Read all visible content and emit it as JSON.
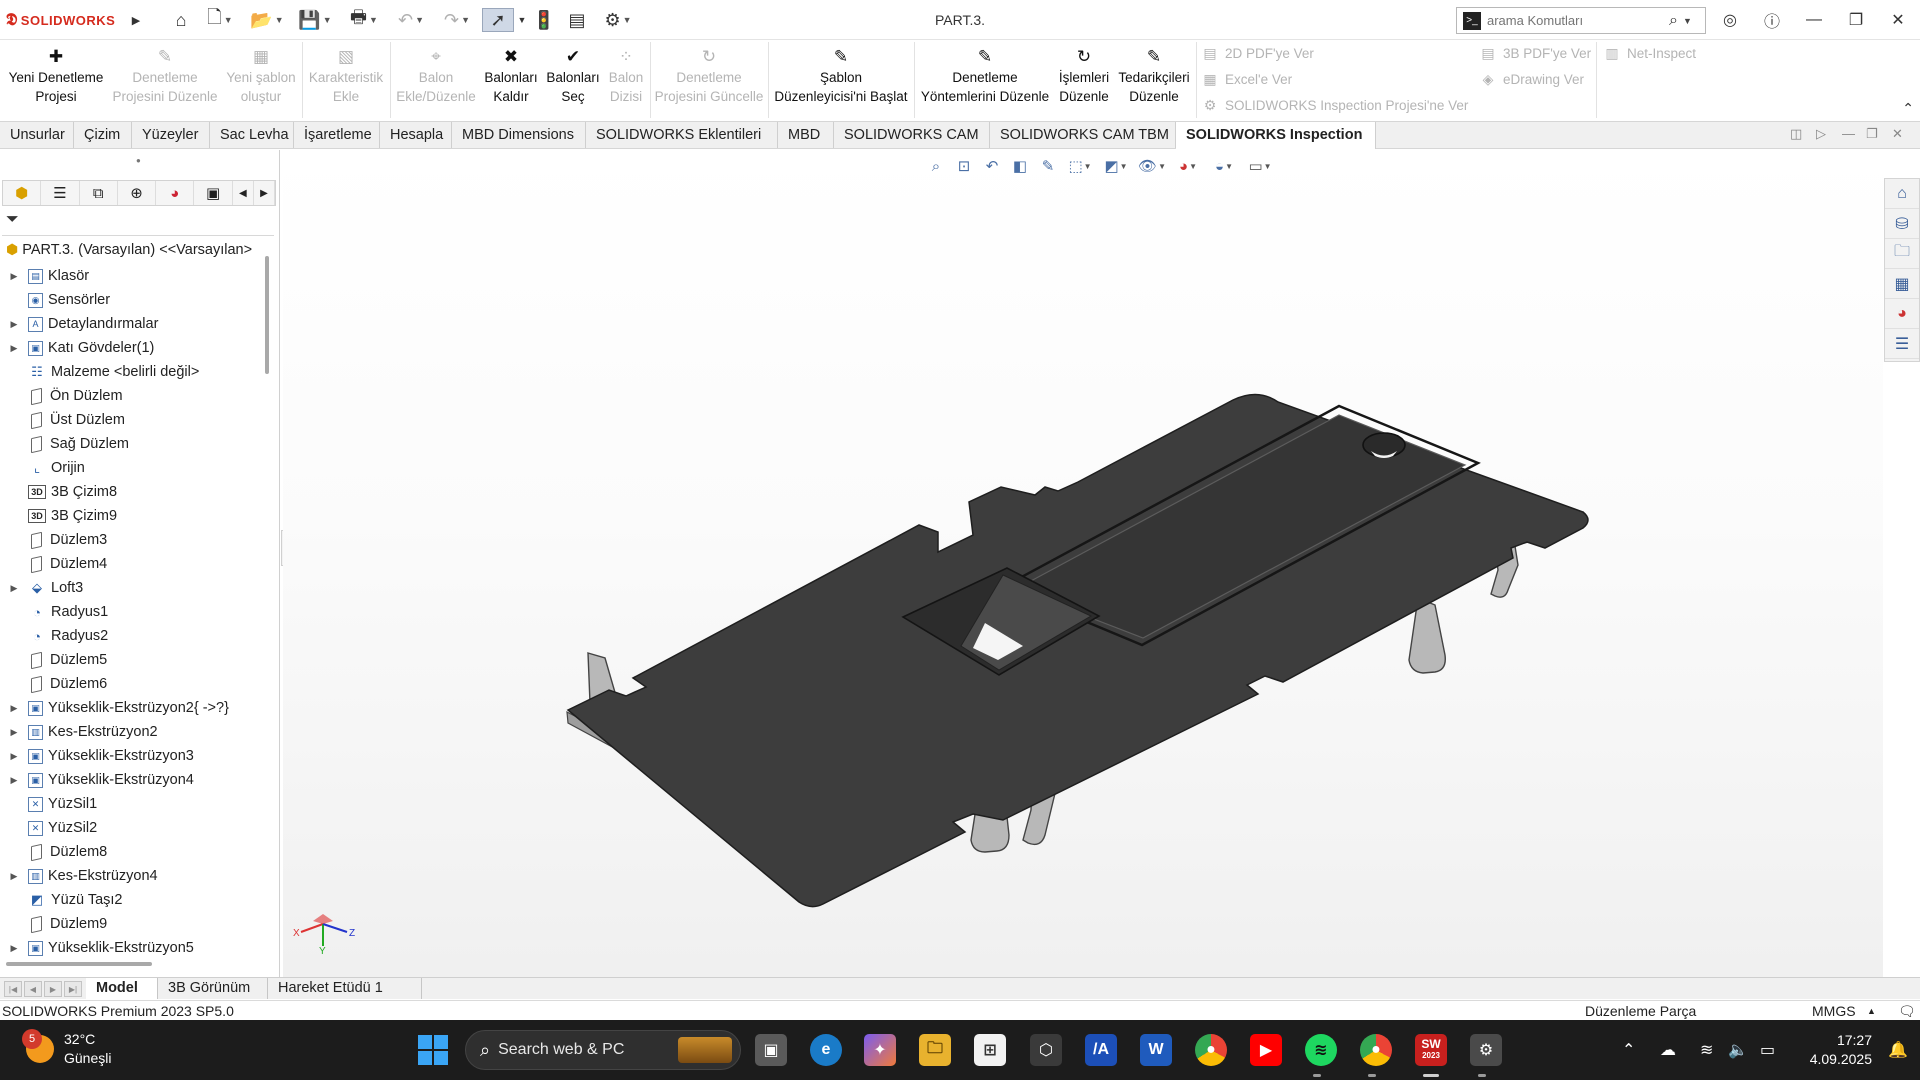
{
  "app": {
    "brand": "SOLIDWORKS",
    "document_title": "PART.3.",
    "search_placeholder": "arama Komutları"
  },
  "command_manager": {
    "left": [
      {
        "line1": "Yeni Denetleme",
        "line2": "Projesi",
        "enabled": true,
        "icon": "new-inspection-icon"
      },
      {
        "line1": "Denetleme",
        "line2": "Projesini Düzenle",
        "enabled": false,
        "icon": "edit-inspection-icon"
      },
      {
        "line1": "Yeni şablon",
        "line2": "oluştur",
        "enabled": false,
        "icon": "new-template-icon"
      },
      {
        "line1": "Karakteristik",
        "line2": "Ekle",
        "enabled": false,
        "icon": "add-characteristic-icon"
      },
      {
        "line1": "Balon",
        "line2": "Ekle/Düzenle",
        "enabled": false,
        "icon": "balloon-icon"
      },
      {
        "line1": "Balonları",
        "line2": "Kaldır",
        "enabled": true,
        "icon": "remove-balloons-icon"
      },
      {
        "line1": "Balonları",
        "line2": "Seç",
        "enabled": true,
        "icon": "select-balloons-icon"
      },
      {
        "line1": "Balon",
        "line2": "Dizisi",
        "enabled": false,
        "icon": "balloon-pattern-icon"
      },
      {
        "line1": "Denetleme",
        "line2": "Projesini Güncelle",
        "enabled": false,
        "icon": "update-inspection-icon"
      },
      {
        "line1": "Şablon",
        "line2": "Düzenleyicisi'ni Başlat",
        "enabled": true,
        "icon": "template-editor-icon"
      },
      {
        "line1": "Denetleme",
        "line2": "Yöntemlerini Düzenle",
        "enabled": true,
        "icon": "edit-methods-icon"
      },
      {
        "line1": "İşlemleri",
        "line2": "Düzenle",
        "enabled": true,
        "icon": "edit-operations-icon"
      },
      {
        "line1": "Tedarikçileri",
        "line2": "Düzenle",
        "enabled": true,
        "icon": "edit-vendors-icon"
      }
    ],
    "export_2d_pdf": "2D PDF'ye Ver",
    "export_excel": "Excel'e Ver",
    "export_inspection_project": "SOLIDWORKS Inspection Projesi'ne Ver",
    "export_3d_pdf": "3B PDF'ye Ver",
    "export_edrawing": "eDrawing Ver",
    "net_inspect": "Net-Inspect"
  },
  "tabs": [
    {
      "label": "Unsurlar",
      "active": false
    },
    {
      "label": "Çizim",
      "active": false
    },
    {
      "label": "Yüzeyler",
      "active": false
    },
    {
      "label": "Sac Levha",
      "active": false
    },
    {
      "label": "İşaretleme",
      "active": false
    },
    {
      "label": "Hesapla",
      "active": false
    },
    {
      "label": "MBD Dimensions",
      "active": false
    },
    {
      "label": "SOLIDWORKS Eklentileri",
      "active": false
    },
    {
      "label": "MBD",
      "active": false
    },
    {
      "label": "SOLIDWORKS CAM",
      "active": false
    },
    {
      "label": "SOLIDWORKS CAM TBM",
      "active": false
    },
    {
      "label": "SOLIDWORKS Inspection",
      "active": true
    }
  ],
  "feature_tree": {
    "root": "PART.3. (Varsayılan) <<Varsayılan>",
    "items": [
      {
        "label": "Klasör",
        "expandable": true,
        "icon": "folder-icon"
      },
      {
        "label": "Sensörler",
        "expandable": false,
        "icon": "sensor-icon"
      },
      {
        "label": "Detaylandırmalar",
        "expandable": true,
        "icon": "annotation-icon"
      },
      {
        "label": "Katı Gövdeler(1)",
        "expandable": true,
        "icon": "solid-bodies-icon"
      },
      {
        "label": "Malzeme <belirli değil>",
        "expandable": false,
        "icon": "material-icon"
      },
      {
        "label": "Ön Düzlem",
        "expandable": false,
        "icon": "plane-icon"
      },
      {
        "label": "Üst Düzlem",
        "expandable": false,
        "icon": "plane-icon"
      },
      {
        "label": "Sağ Düzlem",
        "expandable": false,
        "icon": "plane-icon"
      },
      {
        "label": "Orijin",
        "expandable": false,
        "icon": "origin-icon"
      },
      {
        "label": "3B Çizim8",
        "expandable": false,
        "icon": "sketch-3d-icon"
      },
      {
        "label": "3B Çizim9",
        "expandable": false,
        "icon": "sketch-3d-icon"
      },
      {
        "label": "Düzlem3",
        "expandable": false,
        "icon": "plane-icon"
      },
      {
        "label": "Düzlem4",
        "expandable": false,
        "icon": "plane-icon"
      },
      {
        "label": "Loft3",
        "expandable": true,
        "icon": "loft-icon"
      },
      {
        "label": "Radyus1",
        "expandable": false,
        "icon": "fillet-icon"
      },
      {
        "label": "Radyus2",
        "expandable": false,
        "icon": "fillet-icon"
      },
      {
        "label": "Düzlem5",
        "expandable": false,
        "icon": "plane-icon"
      },
      {
        "label": "Düzlem6",
        "expandable": false,
        "icon": "plane-icon"
      },
      {
        "label": "Yükseklik-Ekstrüzyon2{ ->?}",
        "expandable": true,
        "icon": "boss-extrude-icon"
      },
      {
        "label": "Kes-Ekstrüzyon2",
        "expandable": true,
        "icon": "cut-extrude-icon"
      },
      {
        "label": "Yükseklik-Ekstrüzyon3",
        "expandable": true,
        "icon": "boss-extrude-icon"
      },
      {
        "label": "Yükseklik-Ekstrüzyon4",
        "expandable": true,
        "icon": "boss-extrude-icon"
      },
      {
        "label": "YüzSil1",
        "expandable": false,
        "icon": "delete-face-icon"
      },
      {
        "label": "YüzSil2",
        "expandable": false,
        "icon": "delete-face-icon"
      },
      {
        "label": "Düzlem8",
        "expandable": false,
        "icon": "plane-icon"
      },
      {
        "label": "Kes-Ekstrüzyon4",
        "expandable": true,
        "icon": "cut-extrude-icon"
      },
      {
        "label": "Yüzü Taşı2",
        "expandable": false,
        "icon": "move-face-icon"
      },
      {
        "label": "Düzlem9",
        "expandable": false,
        "icon": "plane-icon"
      },
      {
        "label": "Yükseklik-Ekstrüzyon5",
        "expandable": true,
        "icon": "boss-extrude-icon"
      }
    ]
  },
  "triad": {
    "x": "X",
    "y": "Y",
    "z": "Z"
  },
  "bottom_tabs": [
    {
      "label": "Model",
      "active": true
    },
    {
      "label": "3B Görünüm",
      "active": false
    },
    {
      "label": "Hareket Etüdü 1",
      "active": false
    }
  ],
  "status_bar": {
    "version": "SOLIDWORKS Premium 2023 SP5.0",
    "mode": "Düzenleme Parça",
    "units": "MMGS"
  },
  "taskbar": {
    "weather_badge": "5",
    "temperature": "32°C",
    "condition": "Güneşli",
    "search_text": "Search web & PC",
    "time": "17:27",
    "date": "4.09.2025",
    "sw_badge": "SW",
    "sw_year": "2023"
  },
  "colors": {
    "model_top": "#3d3d3d",
    "model_edge": "#9a9a9a",
    "brand_red": "#d52b1e",
    "accent_blue": "#2a5fa6"
  }
}
